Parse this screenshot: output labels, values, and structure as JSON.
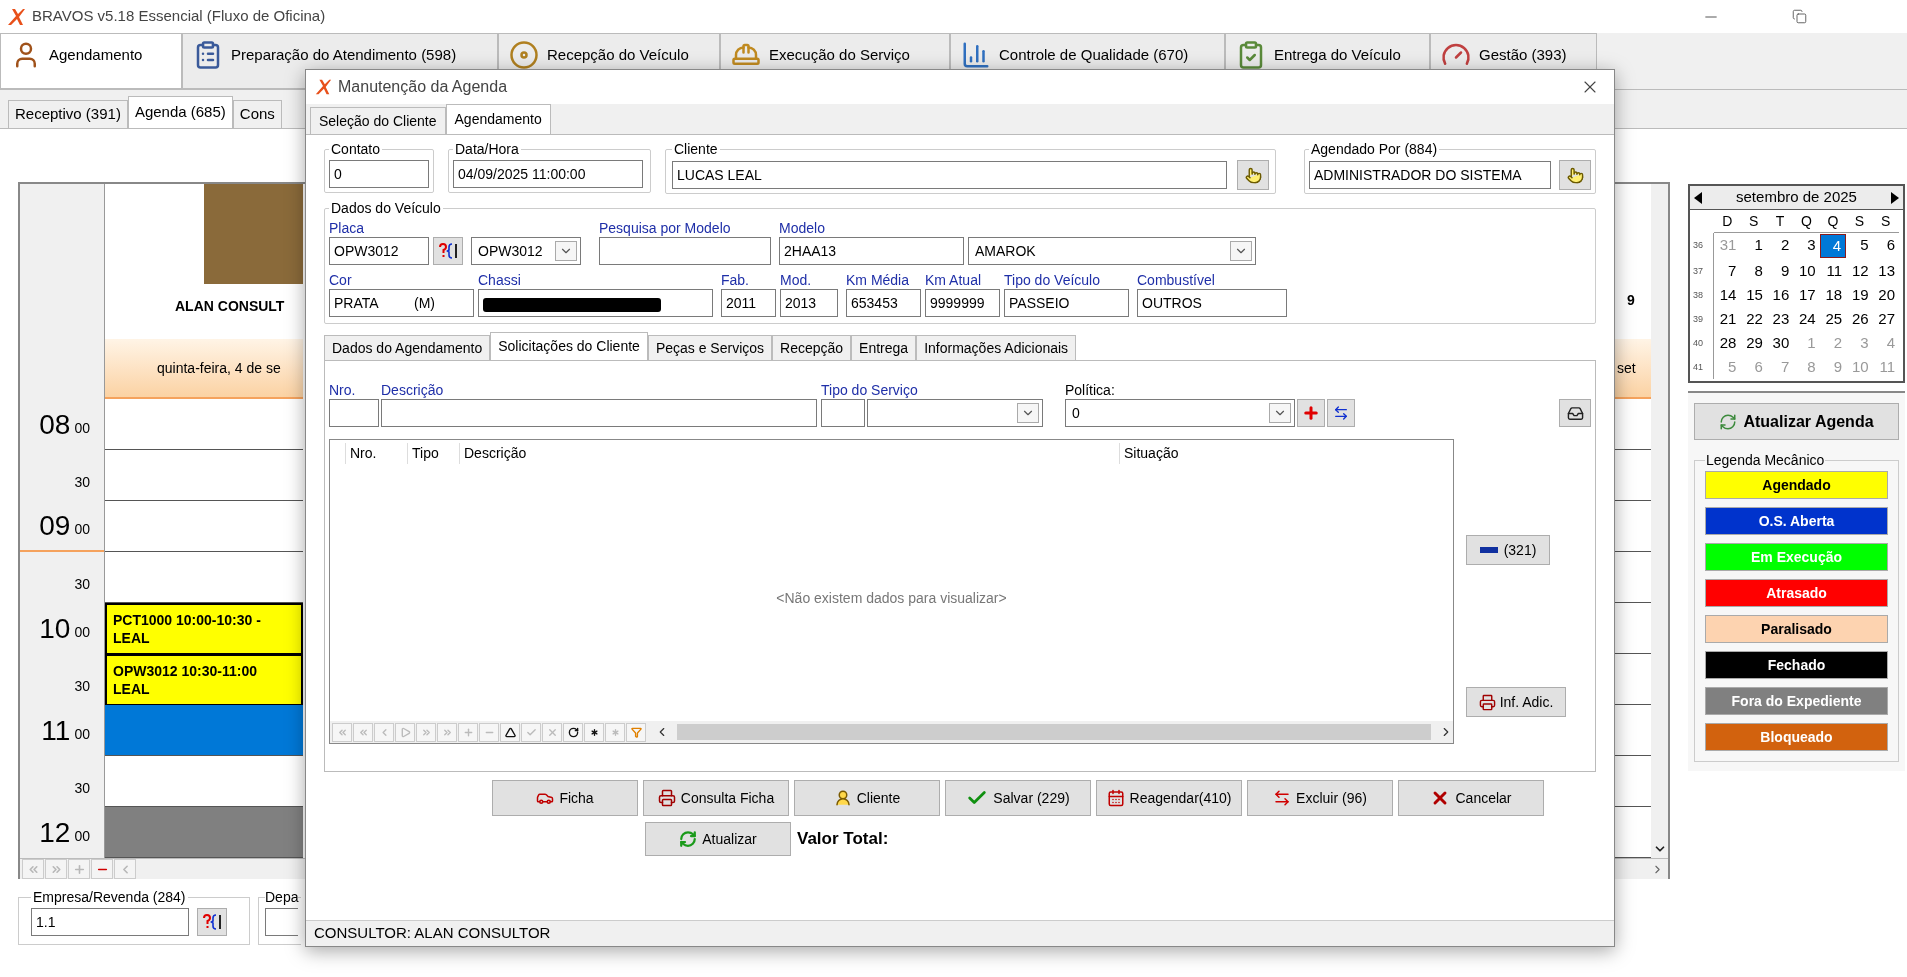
{
  "window": {
    "title": "BRAVOS v5.18 Essencial (Fluxo de Oficina)"
  },
  "main_tabs": [
    {
      "label": "Agendamento",
      "selected": true
    },
    {
      "label": "Preparação do Atendimento (598)",
      "selected": false
    },
    {
      "label": "Recepção do Veículo",
      "selected": false
    },
    {
      "label": "Execução do Serviço",
      "selected": false
    },
    {
      "label": "Controle de Qualidade (670)",
      "selected": false
    },
    {
      "label": "Entrega do Veículo",
      "selected": false
    },
    {
      "label": "Gestão (393)",
      "selected": false
    }
  ],
  "sub_tabs": [
    {
      "label": "Receptivo (391)",
      "selected": false
    },
    {
      "label": "Agenda (685)",
      "selected": true
    },
    {
      "label": "Cons",
      "selected": false
    }
  ],
  "schedule": {
    "consultant": "ALAN CONSULT",
    "date": "quinta-feira, 4 de se",
    "next_header": "9",
    "next_date": "set",
    "slots": [
      {
        "hour": "08",
        "minute": "00",
        "kind": "free"
      },
      {
        "minute": "30",
        "kind": "free"
      },
      {
        "hour": "09",
        "minute": "00",
        "kind": "free"
      },
      {
        "minute": "30",
        "kind": "free"
      },
      {
        "hour": "10",
        "minute": "00",
        "kind": "booked",
        "lines": [
          "PCT1000 10:00-10:30 -",
          "LEAL"
        ]
      },
      {
        "minute": "30",
        "kind": "booked",
        "lines": [
          "OPW3012 10:30-11:00",
          "LEAL"
        ]
      },
      {
        "hour": "11",
        "minute": "00",
        "kind": "current"
      },
      {
        "minute": "30",
        "kind": "free"
      },
      {
        "hour": "12",
        "minute": "00",
        "kind": "unavailable"
      }
    ],
    "navigator": [
      {
        "disabled": true
      },
      {
        "disabled": true
      },
      {
        "disabled": true
      },
      {
        "disabled": false
      },
      {
        "disabled": true
      }
    ]
  },
  "filters": {
    "company": {
      "label": "Empresa/Revenda (284)",
      "value": "1.1"
    },
    "department": {
      "label": "Depa"
    }
  },
  "calendar": {
    "title": "setembro de 2025",
    "weekdays": [
      "D",
      "S",
      "T",
      "Q",
      "Q",
      "S",
      "S"
    ],
    "weeks": [
      {
        "number": "36",
        "days": [
          {
            "day": "31",
            "other_month": true,
            "selected": false
          },
          {
            "day": "1",
            "other_month": false,
            "selected": false
          },
          {
            "day": "2",
            "other_month": false,
            "selected": false
          },
          {
            "day": "3",
            "other_month": false,
            "selected": false
          },
          {
            "day": "4",
            "other_month": false,
            "selected": true
          },
          {
            "day": "5",
            "other_month": false,
            "selected": false
          },
          {
            "day": "6",
            "other_month": false,
            "selected": false
          }
        ]
      },
      {
        "number": "37",
        "days": [
          {
            "day": "7",
            "other_month": false,
            "selected": false
          },
          {
            "day": "8",
            "other_month": false,
            "selected": false
          },
          {
            "day": "9",
            "other_month": false,
            "selected": false
          },
          {
            "day": "10",
            "other_month": false,
            "selected": false
          },
          {
            "day": "11",
            "other_month": false,
            "selected": false
          },
          {
            "day": "12",
            "other_month": false,
            "selected": false
          },
          {
            "day": "13",
            "other_month": false,
            "selected": false
          }
        ]
      },
      {
        "number": "38",
        "days": [
          {
            "day": "14",
            "other_month": false,
            "selected": false
          },
          {
            "day": "15",
            "other_month": false,
            "selected": false
          },
          {
            "day": "16",
            "other_month": false,
            "selected": false
          },
          {
            "day": "17",
            "other_month": false,
            "selected": false
          },
          {
            "day": "18",
            "other_month": false,
            "selected": false
          },
          {
            "day": "19",
            "other_month": false,
            "selected": false
          },
          {
            "day": "20",
            "other_month": false,
            "selected": false
          }
        ]
      },
      {
        "number": "39",
        "days": [
          {
            "day": "21",
            "other_month": false,
            "selected": false
          },
          {
            "day": "22",
            "other_month": false,
            "selected": false
          },
          {
            "day": "23",
            "other_month": false,
            "selected": false
          },
          {
            "day": "24",
            "other_month": false,
            "selected": false
          },
          {
            "day": "25",
            "other_month": false,
            "selected": false
          },
          {
            "day": "26",
            "other_month": false,
            "selected": false
          },
          {
            "day": "27",
            "other_month": false,
            "selected": false
          }
        ]
      },
      {
        "number": "40",
        "days": [
          {
            "day": "28",
            "other_month": false,
            "selected": false
          },
          {
            "day": "29",
            "other_month": false,
            "selected": false
          },
          {
            "day": "30",
            "other_month": false,
            "selected": false
          },
          {
            "day": "1",
            "other_month": true,
            "selected": false
          },
          {
            "day": "2",
            "other_month": true,
            "selected": false
          },
          {
            "day": "3",
            "other_month": true,
            "selected": false
          },
          {
            "day": "4",
            "other_month": true,
            "selected": false
          }
        ]
      },
      {
        "number": "41",
        "days": [
          {
            "day": "5",
            "other_month": true,
            "selected": false
          },
          {
            "day": "6",
            "other_month": true,
            "selected": false
          },
          {
            "day": "7",
            "other_month": true,
            "selected": false
          },
          {
            "day": "8",
            "other_month": true,
            "selected": false
          },
          {
            "day": "9",
            "other_month": true,
            "selected": false
          },
          {
            "day": "10",
            "other_month": true,
            "selected": false
          },
          {
            "day": "11",
            "other_month": true,
            "selected": false
          }
        ]
      }
    ]
  },
  "refresh_button": "Atualizar Agenda",
  "legend": {
    "title": "Legenda Mecânico",
    "items": [
      {
        "label": "Agendado",
        "color": "#ffff00"
      },
      {
        "label": "O.S. Aberta",
        "color": "#0033cc"
      },
      {
        "label": "Em Execução",
        "color": "#00ff00"
      },
      {
        "label": "Atrasado",
        "color": "#ff0000"
      },
      {
        "label": "Paralisado",
        "color": "#fdd3b0"
      },
      {
        "label": "Fechado",
        "color": "#000000"
      },
      {
        "label": "Fora do Expediente",
        "color": "#808080"
      },
      {
        "label": "Bloqueado",
        "color": "#d2620e"
      }
    ]
  },
  "dialog": {
    "title": "Manutenção da Agenda",
    "tabs": [
      {
        "label": "Seleção do Cliente",
        "selected": false
      },
      {
        "label": "Agendamento",
        "selected": true
      }
    ],
    "contact": {
      "label": "Contato",
      "value": "0"
    },
    "datetime": {
      "label": "Data/Hora",
      "value": "04/09/2025 11:00:00"
    },
    "client": {
      "label": "Cliente",
      "value": "LUCAS LEAL"
    },
    "scheduled_by": {
      "label": "Agendado Por (884)",
      "value": "ADMINISTRADOR DO SISTEMA"
    },
    "vehicle": {
      "title": "Dados do Veículo",
      "plate": {
        "label": "Placa",
        "value": "OPW3012"
      },
      "plate_select": {
        "value": "OPW3012"
      },
      "model_search": {
        "label": "Pesquisa por Modelo"
      },
      "model": {
        "label": "Modelo",
        "value": "2HAA13"
      },
      "model_name": {
        "value": "AMAROK"
      },
      "color": {
        "label": "Cor",
        "value": "PRATA",
        "suffix": "(M)"
      },
      "chassis": {
        "label": "Chassi",
        "redacted": true
      },
      "year_made": {
        "label": "Fab.",
        "value": "2011"
      },
      "year_model": {
        "label": "Mod.",
        "value": "2013"
      },
      "km_average": {
        "label": "Km Média",
        "value": "653453"
      },
      "km_current": {
        "label": "Km Atual",
        "value": "9999999"
      },
      "vehicle_type": {
        "label": "Tipo do Veículo",
        "value": "PASSEIO"
      },
      "fuel": {
        "label": "Combustível",
        "value": "OUTROS"
      }
    },
    "inner_tabs": [
      {
        "label": "Dados do Agendamento",
        "selected": false
      },
      {
        "label": "Solicitações do Cliente",
        "selected": true
      },
      {
        "label": "Peças e Serviços",
        "selected": false
      },
      {
        "label": "Recepção",
        "selected": false
      },
      {
        "label": "Entrega",
        "selected": false
      },
      {
        "label": "Informações Adicionais",
        "selected": false
      }
    ],
    "request_form": {
      "number_label": "Nro.",
      "description_label": "Descrição",
      "service_type_label": "Tipo do Serviço",
      "policy": {
        "label": "Política:",
        "value": "0"
      }
    },
    "grid": {
      "columns": [
        "Nro.",
        "Tipo",
        "Descrição",
        "Situação"
      ],
      "empty_message": "<Não existem dados para visualizar>",
      "navigator": [
        {
          "disabled": true
        },
        {
          "disabled": true
        },
        {
          "disabled": true
        },
        {
          "disabled": true
        },
        {
          "disabled": true
        },
        {
          "disabled": true
        },
        {
          "disabled": true
        },
        {
          "disabled": true
        },
        {
          "disabled": false
        },
        {
          "disabled": true
        },
        {
          "disabled": true
        },
        {
          "disabled": false
        },
        {
          "disabled": false
        },
        {
          "disabled": true
        },
        {
          "disabled": false
        }
      ]
    },
    "side_buttons": [
      "(321)",
      "Inf. Adic."
    ],
    "actions": [
      "Ficha",
      "Consulta Ficha",
      "Cliente",
      "Salvar (229)",
      "Reagendar(410)",
      "Excluir (96)",
      "Cancelar"
    ],
    "refresh": "Atualizar",
    "total_label": "Valor Total:",
    "status": "CONSULTOR: ALAN CONSULTOR"
  }
}
